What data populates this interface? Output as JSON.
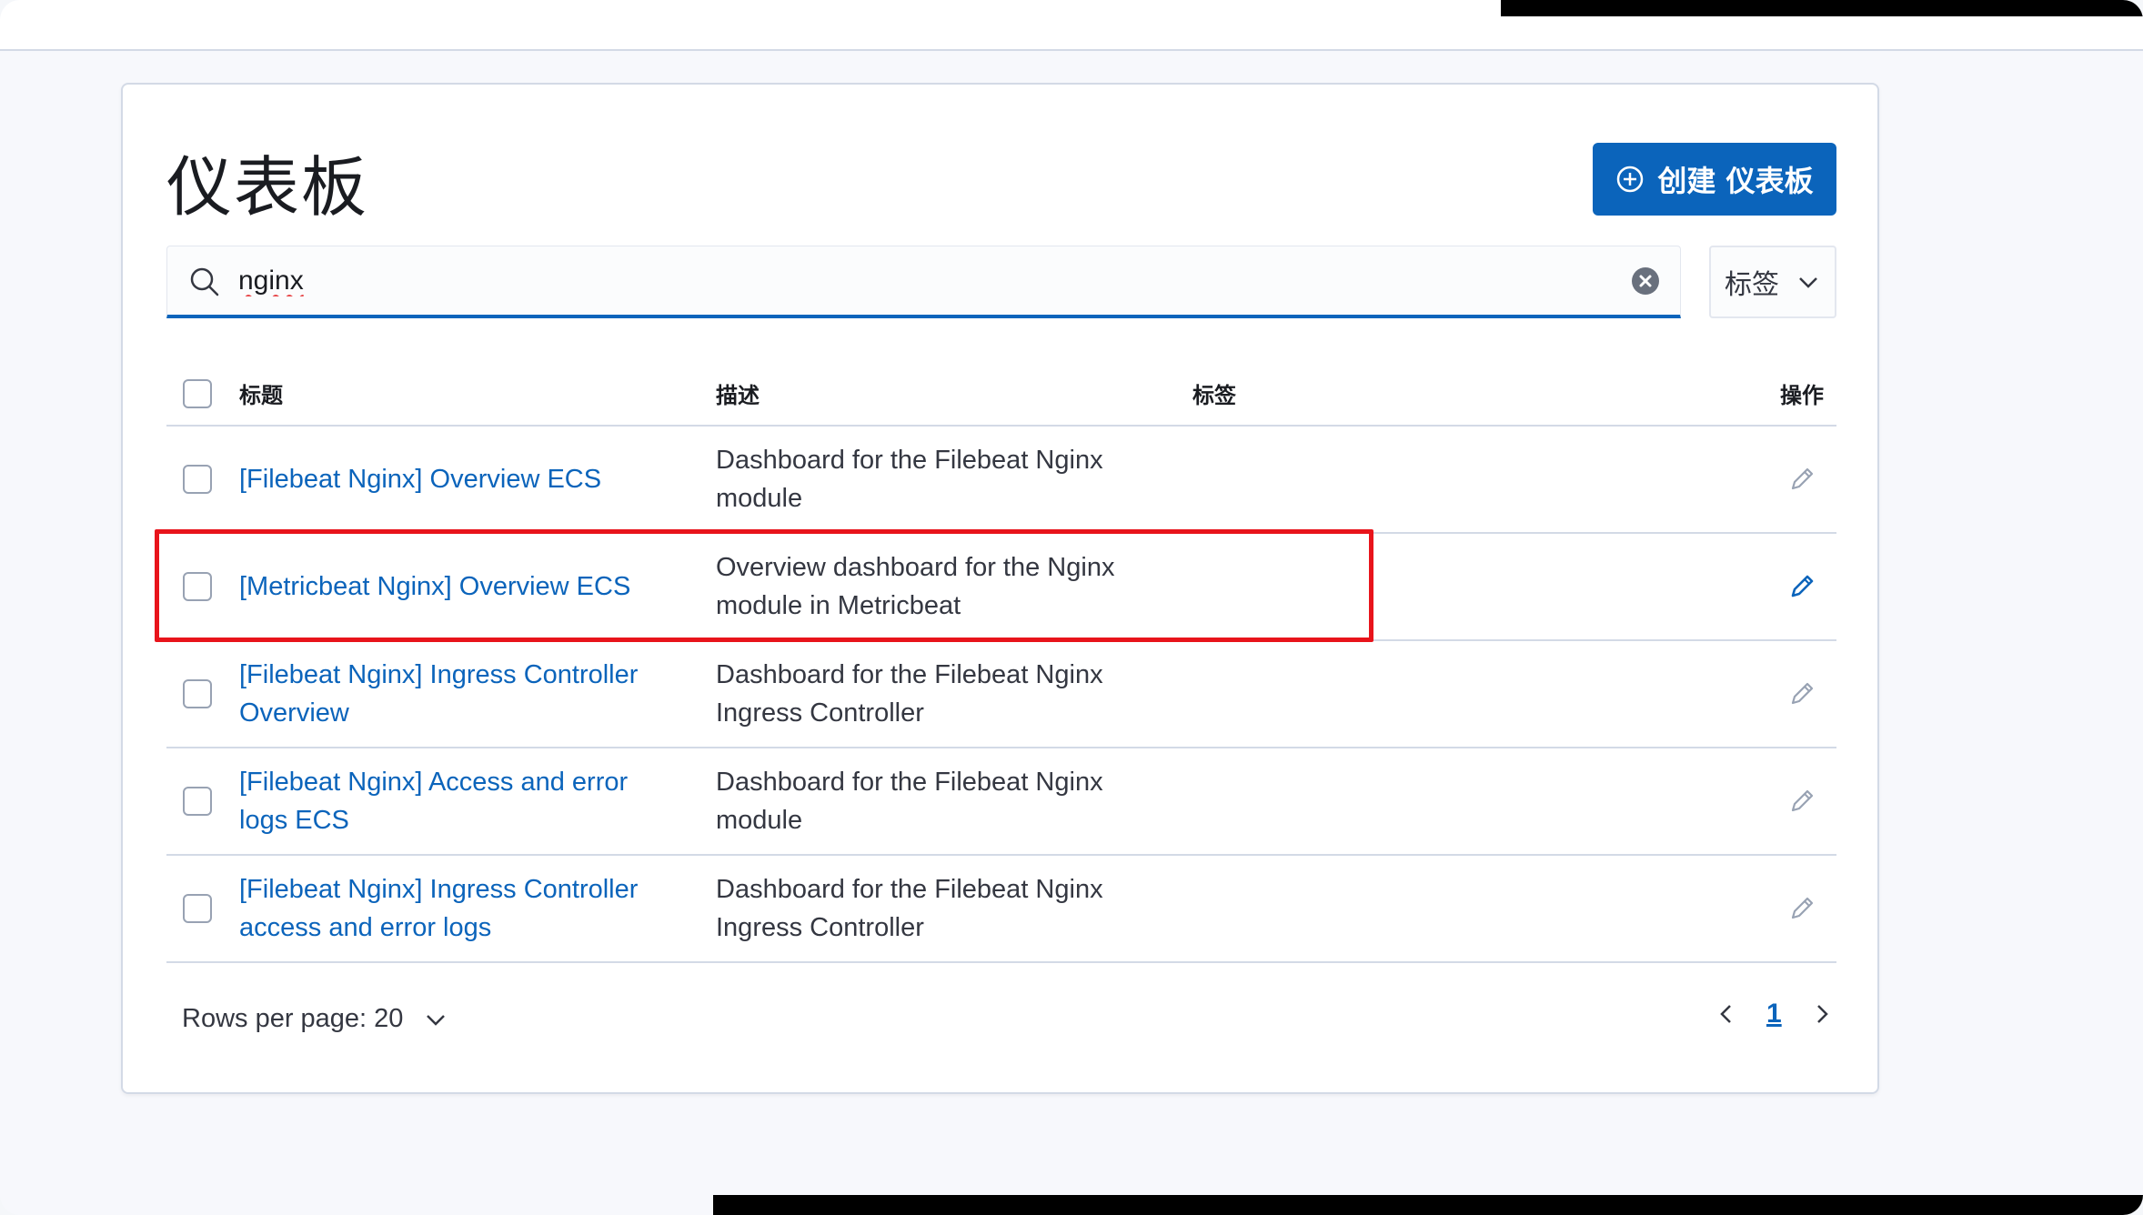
{
  "page": {
    "title": "仪表板",
    "create_button_label": "创建 仪表板"
  },
  "search": {
    "value": "nginx",
    "tags_filter_label": "标签"
  },
  "table": {
    "columns": {
      "title": "标题",
      "description": "描述",
      "tags": "标签",
      "actions": "操作"
    },
    "rows": [
      {
        "title": "[Filebeat Nginx] Overview ECS",
        "description": "Dashboard for the Filebeat Nginx module"
      },
      {
        "title": "[Metricbeat Nginx] Overview ECS",
        "description": "Overview dashboard for the Nginx module in Metricbeat"
      },
      {
        "title": "[Filebeat Nginx] Ingress Controller Overview",
        "description": "Dashboard for the Filebeat Nginx Ingress Controller"
      },
      {
        "title": "[Filebeat Nginx] Access and error logs ECS",
        "description": "Dashboard for the Filebeat Nginx module"
      },
      {
        "title": "[Filebeat Nginx] Ingress Controller access and error logs",
        "description": "Dashboard for the Filebeat Nginx Ingress Controller"
      }
    ]
  },
  "footer": {
    "rows_per_page": "Rows per page: 20",
    "current_page": "1"
  },
  "colors": {
    "accent": "#0b64bb",
    "highlight": "#e8141b"
  },
  "icons": [
    "plus-circle-icon",
    "search-icon",
    "clear-icon",
    "chevron-down-icon",
    "pencil-icon",
    "chevron-left-icon",
    "chevron-right-icon"
  ]
}
